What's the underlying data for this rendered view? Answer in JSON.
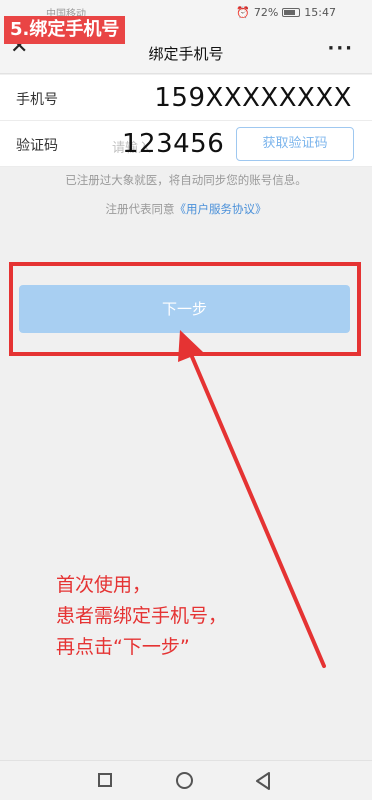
{
  "status_bar": {
    "carrier": "中国移动",
    "battery": "72%",
    "time": "15:47"
  },
  "step_label": "5.绑定手机号",
  "nav": {
    "title": "绑定手机号",
    "close_icon": "close-icon",
    "more_icon": "more-icon"
  },
  "form": {
    "phone_label": "手机号",
    "phone_value": "159XXXXXXXX",
    "code_label": "验证码",
    "code_placeholder": "请输入",
    "code_value": "123456",
    "get_code_button": "获取验证码"
  },
  "notice": "已注册过大象就医，将自动同步您的账号信息。",
  "agreement": {
    "prefix": "注册代表同意",
    "link": "《用户服务协议》"
  },
  "next_button": "下一步",
  "annotation": {
    "line1": "首次使用，",
    "line2": "患者需绑定手机号，",
    "line3": "再点击“下一步”"
  },
  "colors": {
    "annotation_red": "#e53333",
    "button_blue": "#a8cff2",
    "link_blue": "#4a90d9"
  }
}
